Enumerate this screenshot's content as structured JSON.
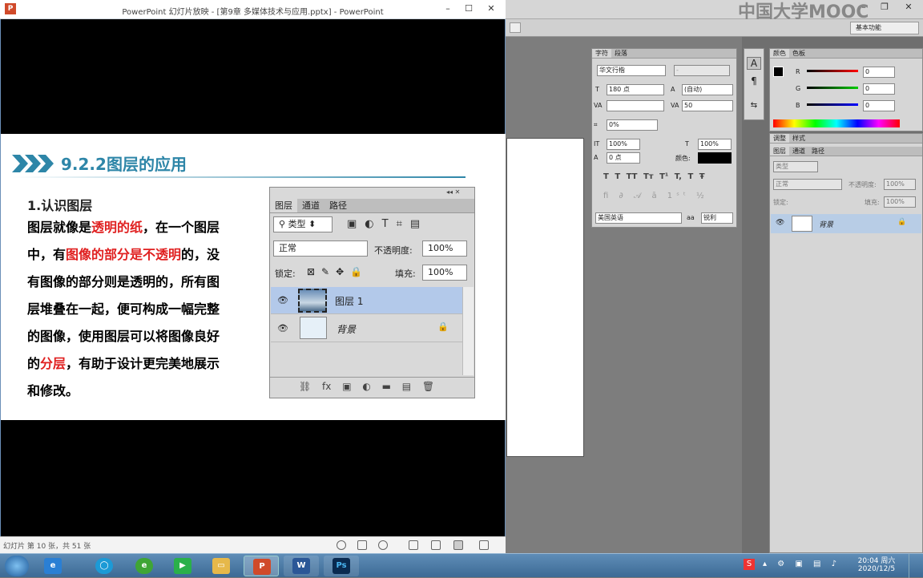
{
  "ppt": {
    "title": "PowerPoint 幻灯片放映 - [第9章 多媒体技术与应用.pptx] - PowerPoint",
    "status": "幻灯片 第 10 张，共 51 张"
  },
  "slide": {
    "heading": "9.2.2图层的应用",
    "sub": "1.认识图层",
    "lines": [
      [
        {
          "t": "图层就像是"
        },
        {
          "t": "透明的纸",
          "r": true
        },
        {
          "t": "，在一个图层"
        }
      ],
      [
        {
          "t": "中，有"
        },
        {
          "t": "图像的部分是不透明",
          "r": true
        },
        {
          "t": "的，没"
        }
      ],
      [
        {
          "t": "有图像的部分则是透明的，所有图"
        }
      ],
      [
        {
          "t": "层堆叠在一起，便可构成一幅完整"
        }
      ],
      [
        {
          "t": "的图像，使用图层可以将图像良好"
        }
      ],
      [
        {
          "t": "的"
        },
        {
          "t": "分层",
          "r": true
        },
        {
          "t": "，有助于设计更完美地展示"
        }
      ],
      [
        {
          "t": "和修改。"
        }
      ]
    ]
  },
  "layers_panel": {
    "tabs": [
      "图层",
      "通道",
      "路径"
    ],
    "filter_label": "类型",
    "blend_mode": "正常",
    "opacity_label": "不透明度:",
    "opacity_value": "100%",
    "lock_label": "锁定:",
    "fill_label": "填充:",
    "fill_value": "100%",
    "layers": [
      {
        "name": "图层 1",
        "selected": true
      },
      {
        "name": "背景",
        "locked": true
      }
    ]
  },
  "photoshop": {
    "watermark": "中国大学MOOC",
    "workspace": "基本功能",
    "char_panel": {
      "tabs": [
        "字符",
        "段落"
      ],
      "font": "华文行楷",
      "style": "-",
      "size": "180 点",
      "leading": "(自动)",
      "tracking": "50",
      "scale": "0%",
      "vscale": "100%",
      "hscale": "100%",
      "baseline": "0 点",
      "color_label": "颜色:",
      "language": "美国英语",
      "aa_label": "aa",
      "aa": "锐利",
      "style_buttons": [
        "T",
        "T",
        "TT",
        "Tт",
        "T¹",
        "T,",
        "T",
        "Ŧ"
      ]
    },
    "color_panel": {
      "tabs": [
        "颜色",
        "色板"
      ],
      "channels": [
        {
          "label": "R",
          "value": "0"
        },
        {
          "label": "G",
          "value": "0"
        },
        {
          "label": "B",
          "value": "0"
        }
      ]
    },
    "adjust_tabs": [
      "调整",
      "样式"
    ],
    "layers_tabs": [
      "图层",
      "通道",
      "路径"
    ],
    "layers_filter": "类型",
    "layers_mode": "正常",
    "layers_opacity_label": "不透明度:",
    "layers_opacity": "100%",
    "layers_lock": "锁定:",
    "layers_fill_label": "填充:",
    "layers_fill": "100%",
    "layers_bg": "背景"
  },
  "taskbar": {
    "time": "20:04 周六",
    "date": "2020/12/5",
    "apps": [
      "start",
      "ie",
      "browser",
      "360",
      "video",
      "explorer",
      "powerpoint",
      "word",
      "photoshop"
    ]
  }
}
